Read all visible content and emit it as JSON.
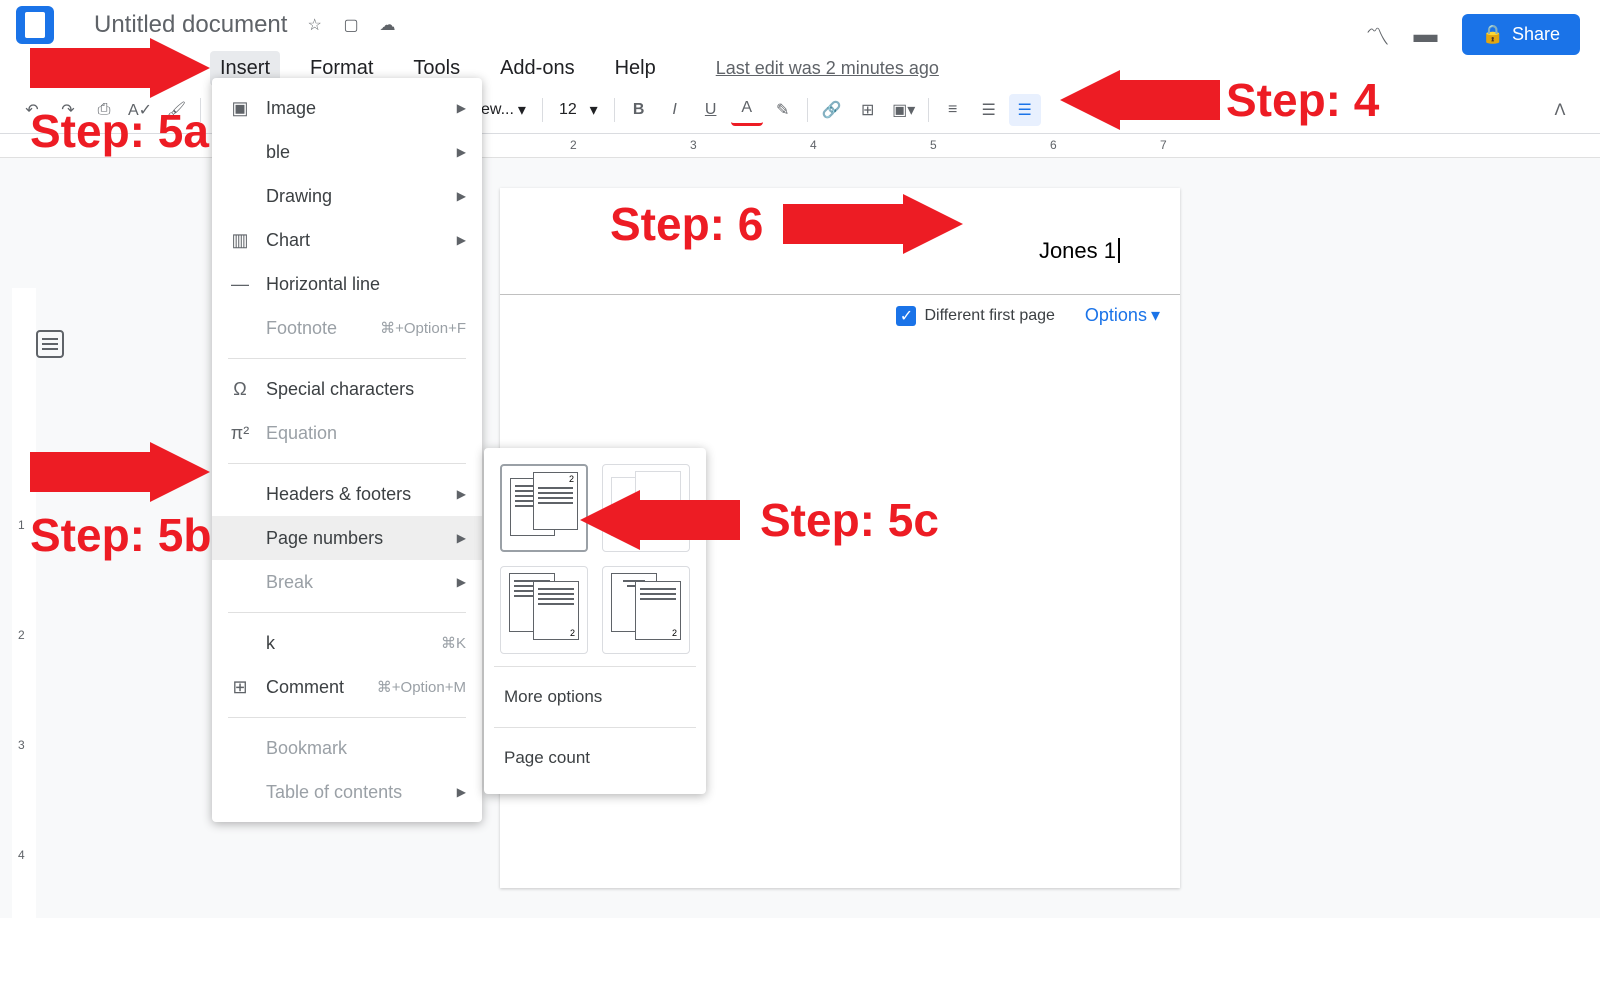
{
  "title": "Untitled document",
  "menubar": {
    "insert": "Insert",
    "format": "Format",
    "tools": "Tools",
    "addons": "Add-ons",
    "help": "Help"
  },
  "last_edit": "Last edit was 2 minutes ago",
  "share": "Share",
  "toolbar": {
    "font_size": "12",
    "view_label": "ew..."
  },
  "ruler": {
    "n2": "2",
    "n3": "3",
    "n4": "4",
    "n5": "5",
    "n6": "6",
    "n7": "7",
    "v1": "1",
    "v2": "2",
    "v3": "3",
    "v4": "4"
  },
  "header": {
    "text": "Jones 1",
    "different_first": "Different first page",
    "options": "Options"
  },
  "insert_menu": {
    "image": "Image",
    "table_suffix": "ble",
    "drawing": "Drawing",
    "chart": "Chart",
    "horizontal_line": "Horizontal line",
    "footnote": "Footnote",
    "footnote_sc": "⌘+Option+F",
    "special_chars": "Special characters",
    "equation": "Equation",
    "headers_footers": "Headers & footers",
    "page_numbers": "Page numbers",
    "break": "Break",
    "link_suffix": "k",
    "link_sc": "⌘K",
    "comment": "Comment",
    "comment_sc": "⌘+Option+M",
    "bookmark": "Bookmark",
    "toc": "Table of contents"
  },
  "submenu": {
    "more_options": "More options",
    "page_count": "Page count"
  },
  "annotations": {
    "step4": "Step: 4",
    "step5a": "Step: 5a",
    "step5b": "Step: 5b",
    "step5c": "Step: 5c",
    "step6": "Step: 6"
  }
}
